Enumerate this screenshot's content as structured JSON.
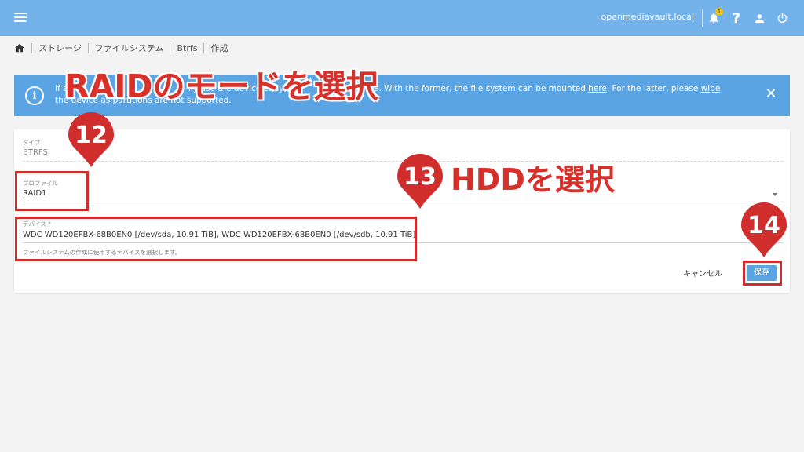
{
  "header": {
    "hostname": "openmediavault.local",
    "notification_count": "1"
  },
  "breadcrumb": [
    "ストレージ",
    "ファイルシステム",
    "Btrfs",
    "作成"
  ],
  "banner": {
    "text_a": "If a",
    "text_b": "lly",
    "text_c": "use the device",
    "text_d": "eady co",
    "text_e": "ns. With the former, the file system can be mounted",
    "link_here": "here",
    "text_f": ". For the latter, please",
    "link_wipe": "wipe",
    "text_g": "the device as partitions are not supported."
  },
  "form": {
    "type_label": "タイプ",
    "type_value": "BTRFS",
    "profile_label": "プロファイル",
    "profile_value": "RAID1",
    "devices_label": "デバイス *",
    "devices_value": "WDC WD120EFBX-68B0EN0 [/dev/sda, 10.91 TiB], WDC WD120EFBX-68B0EN0 [/dev/sdb, 10.91 TiB]",
    "devices_hint": "ファイルシステムの作成に使用するデバイスを選択します。",
    "cancel_label": "キャンセル",
    "save_label": "保存"
  },
  "annotations": {
    "raid_title": "RAIDのモードを選択",
    "hdd_title": "HDDを選択",
    "step_12": "12",
    "step_13": "13",
    "step_14": "14"
  },
  "colors": {
    "topbar": "#73b3ea",
    "banner": "#5ba4e3",
    "annotation_red": "#d02d2d"
  },
  "icons": [
    "menu-icon",
    "bell-icon",
    "help-icon",
    "user-icon",
    "power-icon",
    "home-icon",
    "info-icon",
    "close-icon",
    "chevron-down-icon"
  ]
}
